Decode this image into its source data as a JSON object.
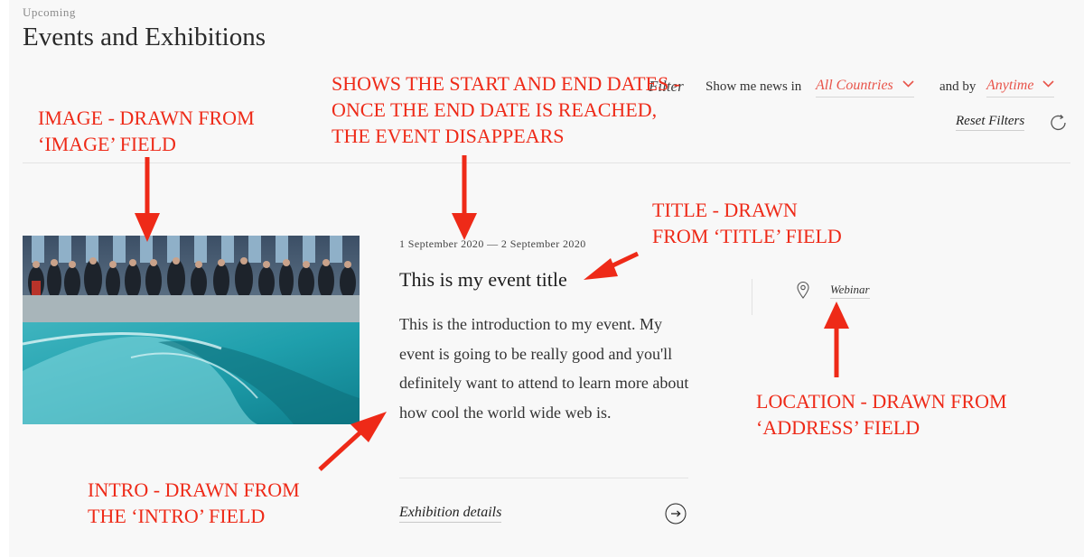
{
  "header": {
    "eyebrow": "Upcoming",
    "title": "Events and Exhibitions"
  },
  "filters": {
    "label": "Filter",
    "show_text": "Show me news in",
    "country_value": "All Countries",
    "by_text": "and by",
    "time_value": "Anytime",
    "reset_label": "Reset Filters"
  },
  "event": {
    "dates": "1 September 2020 — 2 September 2020",
    "title": "This is my event title",
    "intro": "This is the introduction to my event. My event is going to be really good and you'll definitely want to attend to learn more about how cool the world wide web is.",
    "details_label": "Exhibition details",
    "location": "Webinar"
  },
  "annotations": {
    "image": [
      "IMAGE - DRAWN FROM",
      "‘IMAGE’ FIELD"
    ],
    "dates": [
      "SHOWS THE START AND END DATES -",
      "ONCE THE END DATE IS REACHED,",
      "THE EVENT DISAPPEARS"
    ],
    "title": [
      "TITLE - DRAWN",
      "FROM ‘TITLE’ FIELD"
    ],
    "location": [
      "LOCATION - DRAWN FROM",
      "‘ADDRESS’ FIELD"
    ],
    "intro": [
      "INTRO - DRAWN FROM",
      "THE ‘INTRO’ FIELD"
    ]
  },
  "colors": {
    "accent": "#e8544a",
    "annotation": "#ee2a18",
    "background": "#f8f8f8"
  }
}
